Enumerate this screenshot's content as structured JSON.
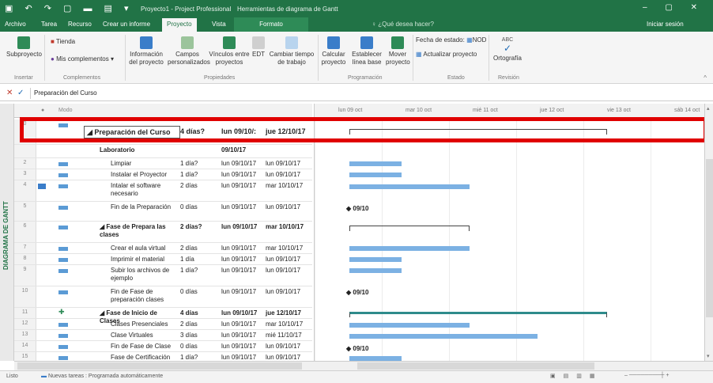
{
  "window": {
    "title": "Proyecto1 - Project Professional",
    "context_title": "Herramientas de diagrama de Gantt"
  },
  "tabs": [
    "Archivo",
    "Tarea",
    "Recurso",
    "Crear un informe",
    "Proyecto",
    "Vista",
    "Formato"
  ],
  "active_tab": "Proyecto",
  "tell_me": "¿Qué desea hacer?",
  "signin": "Iniciar sesión",
  "ribbon": {
    "insertar": {
      "label": "Insertar",
      "subproyecto": "Subproyecto"
    },
    "complementos": {
      "label": "Complementos",
      "tienda": "Tienda",
      "mis": "Mis complementos"
    },
    "propiedades": {
      "label": "Propiedades",
      "info": "Información del proyecto",
      "campos": "Campos personalizados",
      "vinculos": "Vínculos entre proyectos",
      "edt": "EDT",
      "cambiar": "Cambiar tiempo de trabajo"
    },
    "programacion": {
      "label": "Programación",
      "calcular": "Calcular proyecto",
      "establecer": "Establecer línea base",
      "mover": "Mover proyecto"
    },
    "estado": {
      "label": "Estado",
      "fecha": "Fecha de estado:",
      "fecha_val": "NOD",
      "actualizar": "Actualizar proyecto"
    },
    "revision": {
      "label": "Revisión",
      "ortografia": "Ortografía"
    }
  },
  "entry_bar": {
    "value": "Preparación del Curso"
  },
  "side_label": "DIAGRAMA DE GANTT",
  "columns": {
    "modo": "Modo"
  },
  "rows": [
    {
      "id": "0",
      "name": "◢ Preparación del Curso",
      "dur": "4 días?",
      "start": "lun 09/10/:",
      "finish": "jue 12/10/17",
      "bold": true,
      "indent": 0
    },
    {
      "id": "",
      "name": "Laboratorio",
      "dur": "",
      "start": "09/10/17",
      "finish": "",
      "bold": true,
      "indent": 1
    },
    {
      "id": "2",
      "name": "Limpiar",
      "dur": "1 día?",
      "start": "lun 09/10/17",
      "finish": "lun 09/10/17",
      "bold": false,
      "indent": 2
    },
    {
      "id": "3",
      "name": "Instalar el Proyector",
      "dur": "1 día?",
      "start": "lun 09/10/17",
      "finish": "lun 09/10/17",
      "bold": false,
      "indent": 2
    },
    {
      "id": "4",
      "name": "Intalar el software necesario",
      "dur": "2 días",
      "start": "lun 09/10/17",
      "finish": "mar 10/10/17",
      "bold": false,
      "indent": 2
    },
    {
      "id": "5",
      "name": "Fin de la Preparación",
      "dur": "0 días",
      "start": "lun 09/10/17",
      "finish": "lun 09/10/17",
      "bold": false,
      "indent": 2
    },
    {
      "id": "6",
      "name": "◢ Fase de Prepara las clases",
      "dur": "2 días?",
      "start": "lun 09/10/17",
      "finish": "mar 10/10/17",
      "bold": true,
      "indent": 1
    },
    {
      "id": "7",
      "name": "Crear el aula virtual",
      "dur": "2 días",
      "start": "lun 09/10/17",
      "finish": "mar 10/10/17",
      "bold": false,
      "indent": 2
    },
    {
      "id": "8",
      "name": "Imprimir el material",
      "dur": "1 día",
      "start": "lun 09/10/17",
      "finish": "lun 09/10/17",
      "bold": false,
      "indent": 2
    },
    {
      "id": "9",
      "name": "Subir los archivos de ejemplo",
      "dur": "1 día?",
      "start": "lun 09/10/17",
      "finish": "lun 09/10/17",
      "bold": false,
      "indent": 2
    },
    {
      "id": "10",
      "name": "Fin de Fase de preparación clases",
      "dur": "0 días",
      "start": "lun 09/10/17",
      "finish": "lun 09/10/17",
      "bold": false,
      "indent": 2
    },
    {
      "id": "11",
      "name": "◢ Fase de Inicio de Clases",
      "dur": "4 días",
      "start": "lun 09/10/17",
      "finish": "jue 12/10/17",
      "bold": true,
      "indent": 1
    },
    {
      "id": "12",
      "name": "Clases Presenciales",
      "dur": "2 días",
      "start": "lun 09/10/17",
      "finish": "mar 10/10/17",
      "bold": false,
      "indent": 2
    },
    {
      "id": "13",
      "name": "Clase Virtuales",
      "dur": "3 días",
      "start": "lun 09/10/17",
      "finish": "mié 11/10/17",
      "bold": false,
      "indent": 2
    },
    {
      "id": "14",
      "name": "Fin de Fase de Clase",
      "dur": "0 días",
      "start": "lun 09/10/17",
      "finish": "lun 09/10/17",
      "bold": false,
      "indent": 2
    },
    {
      "id": "15",
      "name": "Fase de Certificación",
      "dur": "1 día?",
      "start": "lun 09/10/17",
      "finish": "lun 09/10/17",
      "bold": false,
      "indent": 2
    }
  ],
  "gantt": {
    "days": [
      "lun 09 oct",
      "mar 10 oct",
      "mié 11 oct",
      "jue 12 oct",
      "vie 13 oct",
      "sáb 14 oct"
    ],
    "milestone_label": "09/10"
  },
  "status": {
    "ready": "Listo",
    "new_tasks": "Nuevas tareas : Programada automáticamente"
  },
  "colors": {
    "accent": "#217346",
    "bar": "#7cb1e3",
    "highlight": "#e00000"
  }
}
